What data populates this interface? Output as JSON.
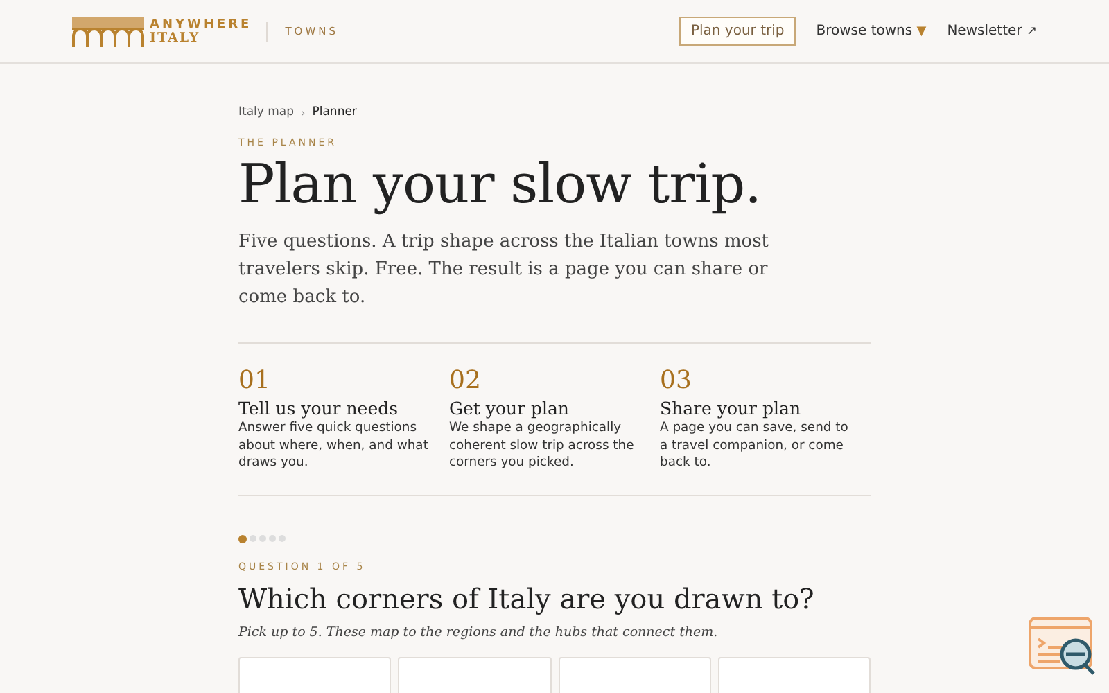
{
  "header": {
    "logo_line_1": "ANYWHERE",
    "logo_line_2": "ITALY",
    "section": "TOWNS",
    "nav": [
      {
        "label": "Plan your trip",
        "kind": "outlined"
      },
      {
        "label": "Browse towns",
        "kind": "dropdown",
        "glyph": "▼"
      },
      {
        "label": "Newsletter",
        "kind": "external",
        "glyph": "↗"
      }
    ]
  },
  "breadcrumb": [
    {
      "label": "Italy map",
      "selected": false
    },
    {
      "label": "Planner",
      "selected": true
    }
  ],
  "breadcrumb_separator": "›",
  "eyebrow": "THE PLANNER",
  "title": "Plan your slow trip.",
  "lead": "Five questions. A trip shape across the Italian towns most travelers skip. Free. The result is a page you can share or come back to.",
  "steps": [
    {
      "number": "01",
      "title": "Tell us your needs",
      "text": "Answer five quick questions about where, when, and what draws you."
    },
    {
      "number": "02",
      "title": "Get your plan",
      "text": "We shape a geographically coherent slow trip across the corners you picked."
    },
    {
      "number": "03",
      "title": "Share your plan",
      "text": "A page you can save, send to a travel companion, or come back to."
    }
  ],
  "progress_dots": [
    {
      "selected": true
    },
    {
      "selected": false
    },
    {
      "selected": false
    },
    {
      "selected": false
    },
    {
      "selected": false
    }
  ],
  "question": {
    "eyebrow": "QUESTION 1 OF 5",
    "title": "Which corners of Italy are you drawn to?",
    "hint": "Pick up to 5. These map to the regions and the hubs that connect them.",
    "options": [
      {
        "kind": "card"
      },
      {
        "kind": "card"
      },
      {
        "kind": "card"
      },
      {
        "kind": "card"
      }
    ]
  }
}
